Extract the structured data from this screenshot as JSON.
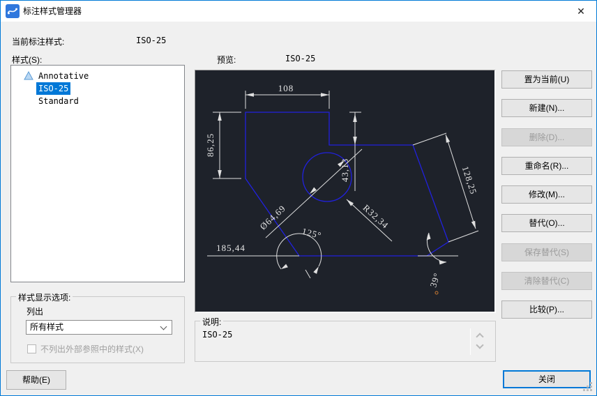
{
  "window": {
    "title": "标注样式管理器",
    "close_glyph": "✕"
  },
  "header": {
    "current_style_label": "当前标注样式:",
    "current_style_value": "ISO-25",
    "styles_label": "样式(S):",
    "preview_label": "预览:",
    "preview_value": "ISO-25"
  },
  "style_list": {
    "items": [
      {
        "label": "Annotative",
        "annotative": true,
        "selected": false
      },
      {
        "label": "ISO-25",
        "annotative": false,
        "selected": true
      },
      {
        "label": "Standard",
        "annotative": false,
        "selected": false
      }
    ]
  },
  "display_options": {
    "group_label": "样式显示选项:",
    "list_label": "列出",
    "dropdown_value": "所有样式",
    "checkbox_label": "不列出外部参照中的样式(X)",
    "checkbox_checked": false,
    "checkbox_enabled": false
  },
  "actions": {
    "items": [
      {
        "label": "置为当前(U)",
        "enabled": true
      },
      {
        "label": "新建(N)...",
        "enabled": true
      },
      {
        "label": "删除(D)...",
        "enabled": false
      },
      {
        "label": "重命名(R)...",
        "enabled": true
      },
      {
        "label": "修改(M)...",
        "enabled": true
      },
      {
        "label": "替代(O)...",
        "enabled": true
      },
      {
        "label": "保存替代(S)",
        "enabled": false
      },
      {
        "label": "清除替代(C)",
        "enabled": false
      },
      {
        "label": "比较(P)...",
        "enabled": true
      }
    ],
    "help_label": "帮助(E)",
    "close_label": "关闭"
  },
  "description": {
    "group_label": "说明:",
    "text": "ISO-25"
  },
  "preview": {
    "colors": {
      "background": "#1e222a",
      "geometry": "#2121de",
      "dimension": "#e6e6e6",
      "selection": "#0078d7"
    },
    "dims": {
      "top": "108",
      "left": "86,25",
      "step": "43,13",
      "slant": "128,25",
      "diameter": "Ø64,69",
      "radius": "R32,34",
      "angle_left": "125°",
      "bottom": "185,44",
      "angle_right": "39°"
    }
  }
}
